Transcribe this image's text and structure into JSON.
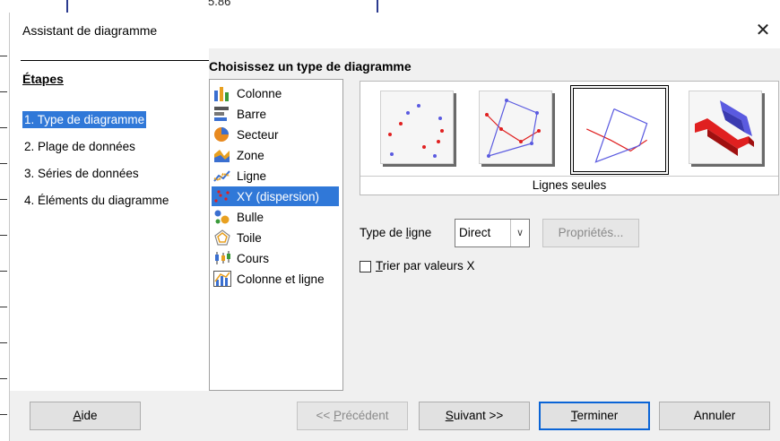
{
  "background": {
    "partial_text": "5.86"
  },
  "window": {
    "title": "Assistant de diagramme",
    "close_symbol": "✕"
  },
  "steps": {
    "heading": "Étapes",
    "items": [
      {
        "label": "1. Type de diagramme",
        "active": true
      },
      {
        "label": "2. Plage de données",
        "active": false
      },
      {
        "label": "3. Séries de données",
        "active": false
      },
      {
        "label": "4. Éléments du diagramme",
        "active": false
      }
    ]
  },
  "main": {
    "section_title": "Choisissez un type de diagramme",
    "chart_types": [
      {
        "label": "Colonne",
        "icon": "column-chart-icon"
      },
      {
        "label": "Barre",
        "icon": "bar-chart-icon"
      },
      {
        "label": "Secteur",
        "icon": "pie-chart-icon"
      },
      {
        "label": "Zone",
        "icon": "area-chart-icon"
      },
      {
        "label": "Ligne",
        "icon": "line-chart-icon"
      },
      {
        "label": "XY (dispersion)",
        "icon": "xy-scatter-icon",
        "selected": true
      },
      {
        "label": "Bulle",
        "icon": "bubble-chart-icon"
      },
      {
        "label": "Toile",
        "icon": "net-chart-icon"
      },
      {
        "label": "Cours",
        "icon": "stock-chart-icon"
      },
      {
        "label": "Colonne et ligne",
        "icon": "column-line-chart-icon"
      }
    ],
    "variants": [
      {
        "name": "points-only",
        "selected": false
      },
      {
        "name": "points-and-lines",
        "selected": false
      },
      {
        "name": "lines-only",
        "selected": true
      },
      {
        "name": "3d-lines",
        "selected": false
      }
    ],
    "variant_caption": "Lignes seules",
    "line_type": {
      "label_prefix": "Type de ",
      "label_underlined": "l",
      "label_suffix": "igne",
      "value": "Direct"
    },
    "properties_button": "Propriétés...",
    "sort_checkbox": {
      "label_underlined": "T",
      "label_rest": "rier par valeurs X",
      "checked": false
    }
  },
  "buttons": {
    "help": {
      "u": "A",
      "rest": "ide"
    },
    "back": {
      "pre": "<< ",
      "u": "P",
      "rest": "récédent"
    },
    "next": {
      "u": "S",
      "rest": "uivant >>"
    },
    "finish": {
      "u": "T",
      "rest": "erminer"
    },
    "cancel": "Annuler"
  },
  "colors": {
    "accent": "#3078d8",
    "default_button_border": "#0a64d6",
    "series_red": "#e02020",
    "series_blue": "#5a5ae0"
  }
}
